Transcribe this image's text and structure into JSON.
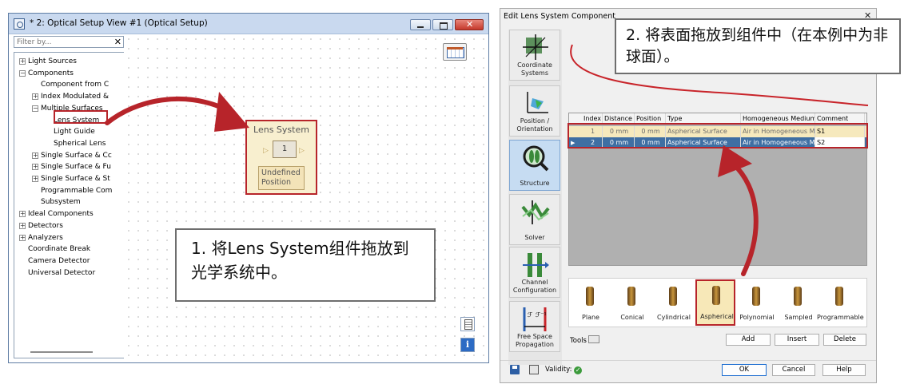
{
  "left_window": {
    "title": "* 2: Optical Setup View #1 (Optical Setup)",
    "filter_placeholder": "Filter by...",
    "tree": [
      {
        "label": "Light Sources",
        "level": 0,
        "expander": "+"
      },
      {
        "label": "Components",
        "level": 0,
        "expander": "−"
      },
      {
        "label": "Component from C",
        "level": 1,
        "expander": ""
      },
      {
        "label": "Index Modulated &",
        "level": 1,
        "expander": "+"
      },
      {
        "label": "Multiple Surfaces",
        "level": 1,
        "expander": "−"
      },
      {
        "label": "Lens System",
        "level": 2,
        "expander": "",
        "highlighted": true
      },
      {
        "label": "Light Guide",
        "level": 2,
        "expander": ""
      },
      {
        "label": "Spherical Lens",
        "level": 2,
        "expander": ""
      },
      {
        "label": "Single Surface & Cc",
        "level": 1,
        "expander": "+"
      },
      {
        "label": "Single Surface & Fu",
        "level": 1,
        "expander": "+"
      },
      {
        "label": "Single Surface & St",
        "level": 1,
        "expander": "+"
      },
      {
        "label": "Programmable Com",
        "level": 1,
        "expander": ""
      },
      {
        "label": "Subsystem",
        "level": 1,
        "expander": ""
      },
      {
        "label": "Ideal Components",
        "level": 0,
        "expander": "+"
      },
      {
        "label": "Detectors",
        "level": 0,
        "expander": "+"
      },
      {
        "label": "Analyzers",
        "level": 0,
        "expander": "+"
      },
      {
        "label": "Coordinate Break",
        "level": 0,
        "expander": ""
      },
      {
        "label": "Camera Detector",
        "level": 0,
        "expander": ""
      },
      {
        "label": "Universal Detector",
        "level": 0,
        "expander": ""
      }
    ],
    "component": {
      "name": "Lens System",
      "index": "1",
      "position_text": "Undefined Position"
    },
    "info_glyph": "i"
  },
  "right_window": {
    "title": "Edit Lens System Component",
    "nav": [
      {
        "label": "Coordinate Systems",
        "icon": "coordinate-systems-icon"
      },
      {
        "label": "Position / Orientation",
        "icon": "position-orientation-icon"
      },
      {
        "label": "Structure",
        "icon": "structure-icon",
        "active": true
      },
      {
        "label": "Solver",
        "icon": "solver-icon"
      },
      {
        "label": "Channel Configuration",
        "icon": "channel-configuration-icon"
      },
      {
        "label": "Free Space Propagation",
        "icon": "free-space-propagation-icon"
      }
    ],
    "table": {
      "headers": [
        "Index",
        "Distance",
        "Position",
        "Type",
        "Homogeneous Medium",
        "Comment"
      ],
      "rows": [
        [
          "1",
          "0 mm",
          "0 mm",
          "Aspherical Surface",
          "Air in Homogeneous M",
          "S1"
        ],
        [
          "2",
          "0 mm",
          "0 mm",
          "Aspherical Surface",
          "Air in Homogeneous M",
          "S2"
        ]
      ]
    },
    "surfaces": [
      "Plane",
      "Conical",
      "Cylindrical",
      "Aspherical",
      "Polynomial",
      "Sampled",
      "Programmable"
    ],
    "highlighted_surface": "Aspherical",
    "tools_label": "Tools",
    "buttons": {
      "add": "Add",
      "insert": "Insert",
      "delete": "Delete",
      "ok": "OK",
      "cancel": "Cancel",
      "help": "Help"
    },
    "validity_label": "Validity:"
  },
  "callouts": {
    "step1": "1. 将Lens System组件拖放到光学系统中。",
    "step2": "2. 将表面拖放到组件中（在本例中为非球面）。"
  },
  "colors": {
    "highlight_red": "#b7242a",
    "component_fill": "#f8efcf",
    "selected_row": "#3f6fa3",
    "active_nav": "#c6dcf2"
  }
}
